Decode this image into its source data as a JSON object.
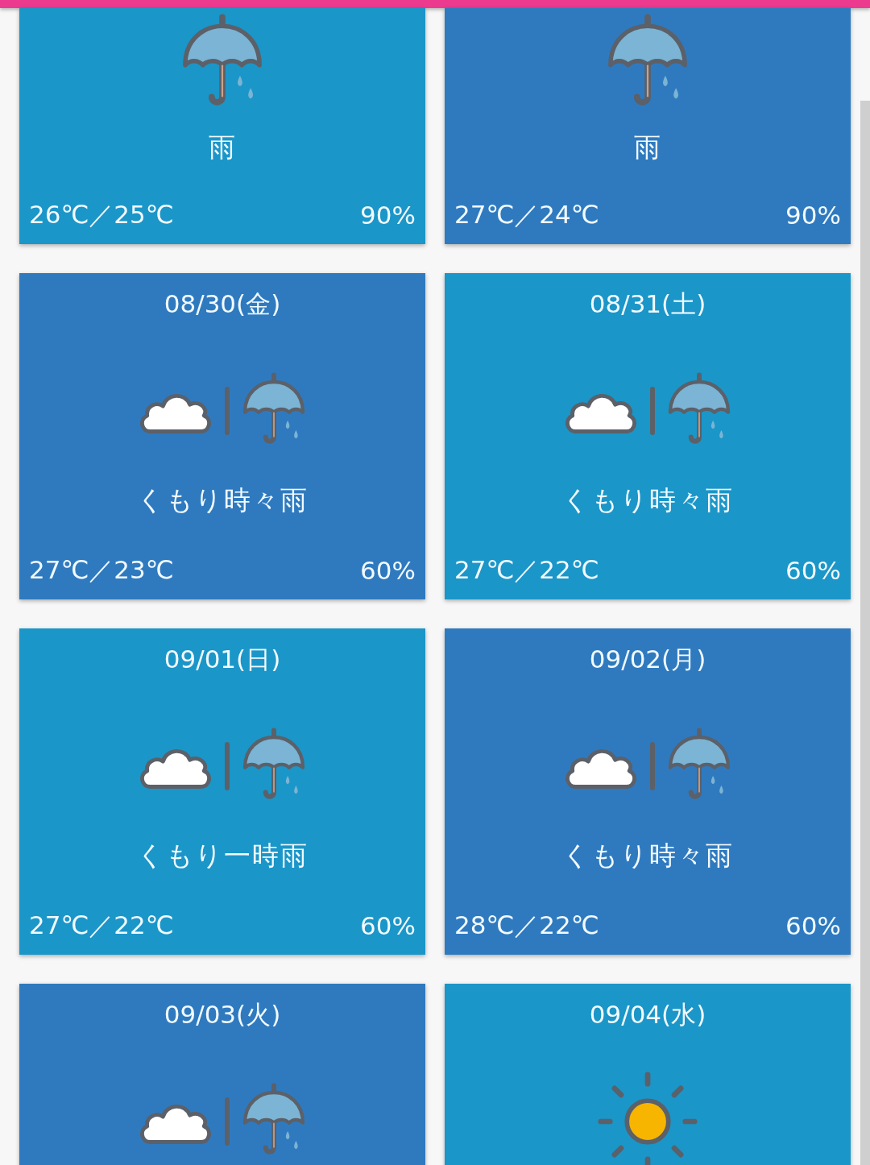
{
  "cards": [
    {
      "color": "#1b96c8",
      "kind": "rain",
      "condition": "雨",
      "temps": "26℃／25℃",
      "chance": "90%"
    },
    {
      "color": "#2f7abf",
      "kind": "rain",
      "condition": "雨",
      "temps": "27℃／24℃",
      "chance": "90%"
    },
    {
      "color": "#2f7abf",
      "date": "08/30(金)",
      "kind": "cloudrain",
      "condition": "くもり時々雨",
      "temps": "27℃／23℃",
      "chance": "60%"
    },
    {
      "color": "#1b96c8",
      "date": "08/31(土)",
      "kind": "cloudrain",
      "condition": "くもり時々雨",
      "temps": "27℃／22℃",
      "chance": "60%"
    },
    {
      "color": "#1b96c8",
      "date": "09/01(日)",
      "kind": "cloudrain",
      "condition": "くもり一時雨",
      "temps": "27℃／22℃",
      "chance": "60%"
    },
    {
      "color": "#2f7abf",
      "date": "09/02(月)",
      "kind": "cloudrain",
      "condition": "くもり時々雨",
      "temps": "28℃／22℃",
      "chance": "60%"
    },
    {
      "color": "#2f7abf",
      "date": "09/03(火)",
      "kind": "cloudrain"
    },
    {
      "color": "#1b96c8",
      "date": "09/04(水)",
      "kind": "sun"
    }
  ]
}
